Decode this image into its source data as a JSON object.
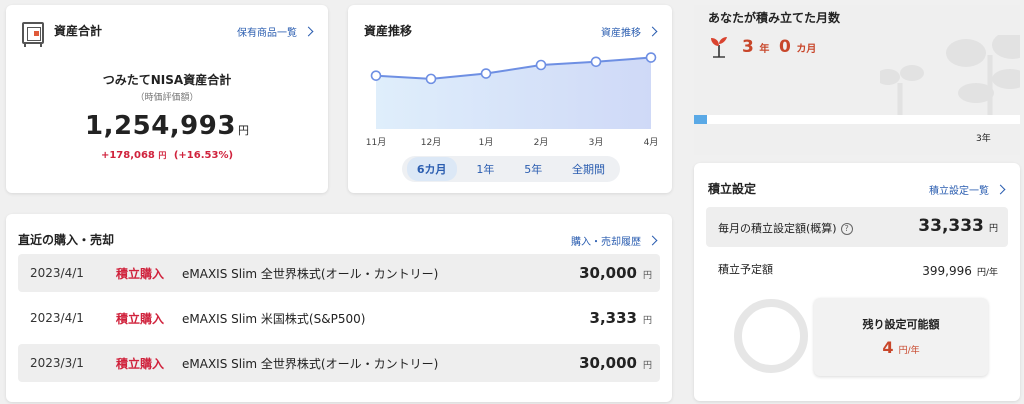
{
  "assets": {
    "title": "資産合計",
    "link": "保有商品一覧",
    "subtitle": "つみたてNISA資産合計",
    "note": "（時価評価額）",
    "total": "1,254,993",
    "total_unit": "円",
    "gain": "+178,068",
    "gain_unit": "円",
    "gain_pct": "(+16.53%)"
  },
  "trend": {
    "title": "資産推移",
    "link": "資産推移",
    "months": [
      "11月",
      "12月",
      "1月",
      "2月",
      "3月",
      "4月"
    ],
    "tabs": [
      "6カ月",
      "1年",
      "5年",
      "全期間"
    ],
    "active_tab": "6カ月"
  },
  "chart_data": {
    "type": "area",
    "x": [
      "11月",
      "12月",
      "1月",
      "2月",
      "3月",
      "4月"
    ],
    "series": [
      {
        "values": [
          1.0,
          0.97,
          1.02,
          1.1,
          1.13,
          1.17
        ]
      }
    ],
    "title": "",
    "xlabel": "",
    "ylabel": "",
    "grid": false,
    "colors": {
      "line": "#6e8fe3",
      "fill_top": "#cfd9f7",
      "fill_bottom": "#dfeefb"
    }
  },
  "trades": {
    "title": "直近の購入・売却",
    "link": "購入・売却履歴",
    "rows": [
      {
        "date": "2023/4/1",
        "type": "積立購入",
        "name": "eMAXIS Slim 全世界株式(オール・カントリー)",
        "amount": "30,000",
        "unit": "円"
      },
      {
        "date": "2023/4/1",
        "type": "積立購入",
        "name": "eMAXIS Slim 米国株式(S&P500)",
        "amount": "3,333",
        "unit": "円"
      },
      {
        "date": "2023/3/1",
        "type": "積立購入",
        "name": "eMAXIS Slim 全世界株式(オール・カントリー)",
        "amount": "30,000",
        "unit": "円"
      }
    ]
  },
  "months_panel": {
    "title": "あなたが積み立てた月数",
    "years": "3",
    "years_unit": "年",
    "months": "0",
    "months_unit": "カ月",
    "progress": 0.04,
    "marker_label": "3年"
  },
  "settings": {
    "title": "積立設定",
    "link": "積立設定一覧",
    "monthly_label": "毎月の積立設定額(概算)",
    "help_icon": "?",
    "monthly_value": "33,333",
    "monthly_unit": "円",
    "planned_label": "積立予定額",
    "planned_value": "399,996",
    "planned_unit": "円/年",
    "remaining_label": "残り設定可能額",
    "remaining_value": "4",
    "remaining_unit": "円/年"
  },
  "colors": {
    "accent_blue": "#2a5db0",
    "red": "#d0223c",
    "orange": "#c8462a",
    "progress": "#5aa9e6"
  }
}
